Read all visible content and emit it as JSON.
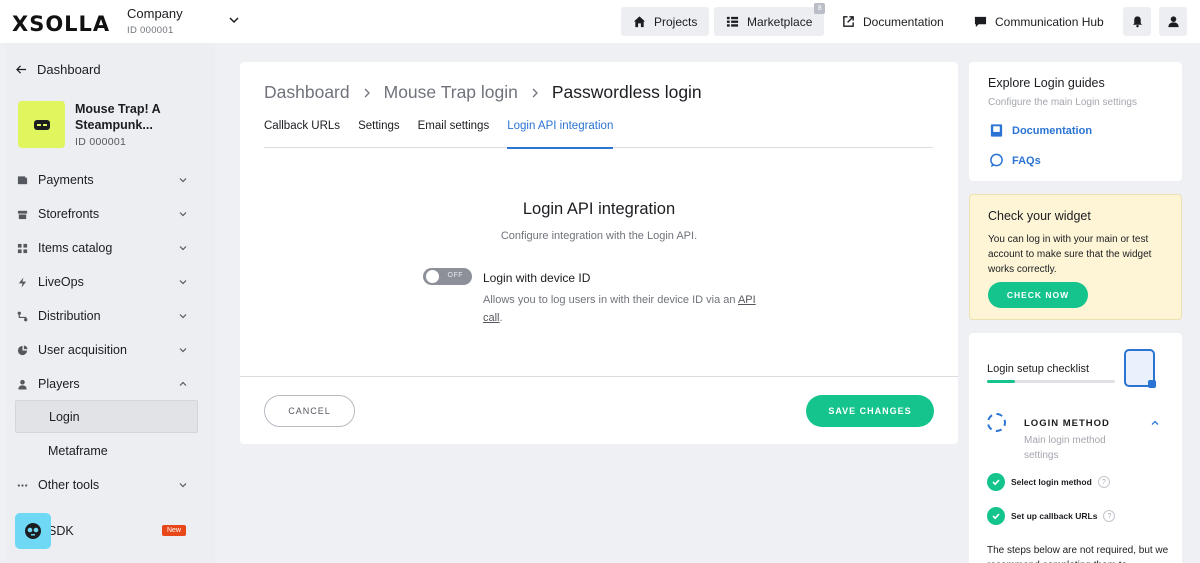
{
  "topbar": {
    "logo": "XSOLLA",
    "company_name": "Company",
    "company_id": "ID 000001",
    "projects": "Projects",
    "marketplace": "Marketplace",
    "marketplace_badge": "8",
    "documentation": "Documentation",
    "communication_hub": "Communication Hub"
  },
  "sidebar": {
    "back_label": "Dashboard",
    "project_title": "Mouse Trap! A Steampunk...",
    "project_id": "ID 000001",
    "items": [
      {
        "label": "Payments",
        "icon": "wallet-icon"
      },
      {
        "label": "Storefronts",
        "icon": "store-icon"
      },
      {
        "label": "Items catalog",
        "icon": "grid-icon"
      },
      {
        "label": "LiveOps",
        "icon": "bolt-icon"
      },
      {
        "label": "Distribution",
        "icon": "share-icon"
      },
      {
        "label": "User acquisition",
        "icon": "chart-icon"
      },
      {
        "label": "Players",
        "icon": "person-icon"
      }
    ],
    "sub_items": [
      "Login",
      "Metaframe"
    ],
    "other_tools": "Other tools",
    "sdk": "SDK",
    "sdk_badge": "New"
  },
  "main": {
    "breadcrumb": [
      "Dashboard",
      "Mouse Trap login",
      "Passwordless login"
    ],
    "tabs": [
      "Callback URLs",
      "Settings",
      "Email settings",
      "Login API integration"
    ],
    "active_tab": "Login API integration",
    "section_title": "Login API integration",
    "section_subtitle": "Configure integration with the Login API.",
    "toggle_state": "OFF",
    "option_label": "Login with device ID",
    "option_desc": "Allows you to log users in with their device ID via an",
    "option_link": "API call",
    "cancel": "CANCEL",
    "save": "SAVE CHANGES"
  },
  "guides": {
    "title": "Explore Login guides",
    "subtitle": "Configure the main Login settings",
    "documentation": "Documentation",
    "faqs": "FAQs"
  },
  "widget": {
    "title": "Check your widget",
    "desc": "You can log in with your main or test account to make sure that the widget works correctly.",
    "button": "CHECK NOW"
  },
  "checklist": {
    "title": "Login setup checklist",
    "progress": 0.22,
    "method_title": "LOGIN METHOD",
    "method_sub": "Main login method settings",
    "steps": [
      "Select login method",
      "Set up callback URLs"
    ],
    "step_help": "?",
    "note": "The steps below are not required, but we recommend completing them to"
  },
  "colors": {
    "accent": "#15c48d",
    "link": "#2b74d4",
    "badge_new": "#e8471a",
    "project_thumb": "#e0f55e"
  }
}
